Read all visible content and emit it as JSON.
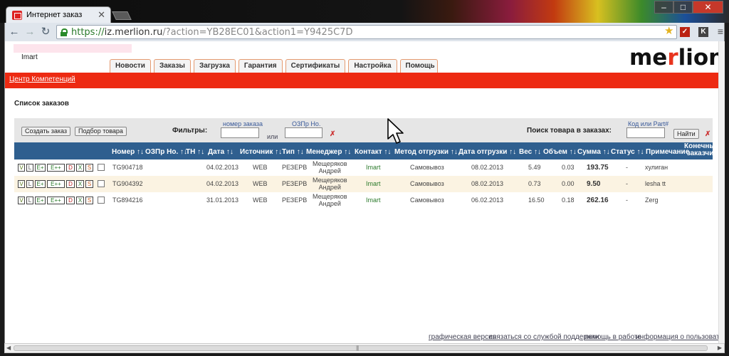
{
  "browser": {
    "tab_title": "Интернет заказ",
    "tab_close": "✕",
    "url_scheme": "https://",
    "url_host": "iz.merlion.ru",
    "url_path": "/?action=YB28EC01&action1=Y9425C7D",
    "win_min": "–",
    "win_max": "□",
    "win_close": "✕"
  },
  "header": {
    "username": "Imart",
    "logo_pre": "me",
    "logo_accent": "r",
    "logo_post": "lion",
    "accent_color": "#ed2a12"
  },
  "nav_tabs": [
    "Новости",
    "Заказы",
    "Загрузка",
    "Гарантия",
    "Сертификаты",
    "Настройка",
    "Помощь"
  ],
  "competence_link": "Центр Компетенций",
  "section_title": "Список заказов",
  "filters": {
    "create_order": "Создать заказ",
    "pick_goods": "Подбор товара",
    "filters_label": "Фильтры:",
    "order_num_hint": "номер заказа",
    "ozpr_hint": "ОЗПр Но.",
    "or_label": "или",
    "search_label": "Поиск товара в заказах:",
    "code_hint": "Код или Part#",
    "find_button": "Найти"
  },
  "table": {
    "headers": {
      "num": "Номер ↑↓",
      "ozpr": "ОЗПр Но. ↑↓",
      "tn": "ТН ↑↓",
      "date": "Дата ↑↓",
      "source": "Источник ↑↓",
      "type": "Тип ↑↓",
      "manager": "Менеджер ↑↓",
      "contact": "Контакт ↑↓",
      "ship_method": "Метод отгрузки ↑↓",
      "ship_date": "Дата отгрузки ↑↓",
      "weight": "Вес ↑↓",
      "volume": "Объем ↑↓",
      "sum": "Сумма ↑↓",
      "status": "Статус ↑↓",
      "note": "Примечание",
      "final_customer_1": "Конечный",
      "final_customer_2": "заказчик"
    },
    "action_buttons": [
      "V",
      "L",
      "E+",
      "E++",
      "D",
      "X",
      "S"
    ],
    "rows": [
      {
        "num": "TG904718",
        "date": "04.02.2013",
        "source": "WEB",
        "type": "РЕЗЕРВ",
        "manager_1": "Мещеряков",
        "manager_2": "Андрей",
        "contact": "Imart",
        "ship_method": "Самовывоз",
        "ship_date": "08.02.2013",
        "weight": "5.49",
        "volume": "0.03",
        "sum": "193.75",
        "status": "-",
        "note": "хулиган"
      },
      {
        "num": "TG904392",
        "date": "04.02.2013",
        "source": "WEB",
        "type": "РЕЗЕРВ",
        "manager_1": "Мещеряков",
        "manager_2": "Андрей",
        "contact": "Imart",
        "ship_method": "Самовывоз",
        "ship_date": "08.02.2013",
        "weight": "0.73",
        "volume": "0.00",
        "sum": "9.50",
        "status": "-",
        "note": "lesha tt"
      },
      {
        "num": "TG894216",
        "date": "31.01.2013",
        "source": "WEB",
        "type": "РЕЗЕРВ",
        "manager_1": "Мещеряков",
        "manager_2": "Андрей",
        "contact": "Imart",
        "ship_method": "Самовывоз",
        "ship_date": "06.02.2013",
        "weight": "16.50",
        "volume": "0.18",
        "sum": "262.16",
        "status": "-",
        "note": "Zerg"
      }
    ]
  },
  "footer_links": [
    "графическая версия",
    "связаться со службой поддержки",
    "помощь в работе",
    "информация о пользователе"
  ]
}
